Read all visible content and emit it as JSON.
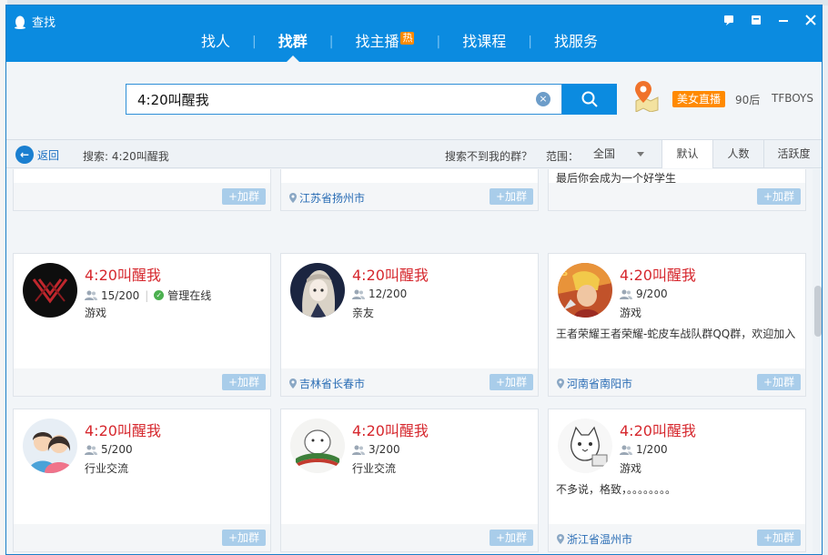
{
  "window": {
    "title": "查找"
  },
  "nav": {
    "items": [
      {
        "label": "找人"
      },
      {
        "label": "找群"
      },
      {
        "label": "找主播",
        "badge": "热"
      },
      {
        "label": "找课程"
      },
      {
        "label": "找服务"
      }
    ],
    "separator": "|"
  },
  "search": {
    "value": "4:20叫醒我",
    "tags": {
      "live": "美女直播",
      "age": "90后",
      "star": "TFBOYS"
    }
  },
  "filter": {
    "back": "返回",
    "crumb": "搜索: 4:20叫醒我",
    "no_find": "搜索不到我的群？",
    "range_label": "范围：",
    "range_value": "全国",
    "sort": [
      "默认",
      "人数",
      "活跃度"
    ]
  },
  "join_label": "+加群",
  "top_row": {
    "col2_location": "江苏省扬州市",
    "col3_desc": "最后你会成为一个好学生"
  },
  "groups": [
    {
      "name": "4:20叫醒我",
      "members": "15/200",
      "online": "管理在线",
      "category": "游戏",
      "desc": "",
      "location": "吉林省长春市",
      "avatar": "dark-logo-icon"
    },
    {
      "name": "4:20叫醒我",
      "members": "12/200",
      "online": "",
      "category": "亲友",
      "desc": "",
      "location": "吉林省长春市",
      "avatar": "anime-girl-icon"
    },
    {
      "name": "4:20叫醒我",
      "members": "9/200",
      "online": "",
      "category": "游戏",
      "desc": "王者荣耀王者荣耀-蛇皮车战队群QQ群，欢迎加入",
      "location": "河南省南阳市",
      "avatar": "game-hero-icon"
    },
    {
      "name": "4:20叫醒我",
      "members": "5/200",
      "online": "",
      "category": "行业交流",
      "desc": "",
      "location": "",
      "avatar": "couple-icon"
    },
    {
      "name": "4:20叫醒我",
      "members": "3/200",
      "online": "",
      "category": "行业交流",
      "desc": "",
      "location": "",
      "avatar": "cartoon-bird-icon"
    },
    {
      "name": "4:20叫醒我",
      "members": "1/200",
      "online": "",
      "category": "游戏",
      "desc": "不多说，格致，。。。。。。。。",
      "location": "浙江省温州市",
      "avatar": "cat-sketch-icon"
    }
  ],
  "colors": {
    "accent": "#0b8be0",
    "name": "#d6282e",
    "hot": "#ff8a00"
  }
}
